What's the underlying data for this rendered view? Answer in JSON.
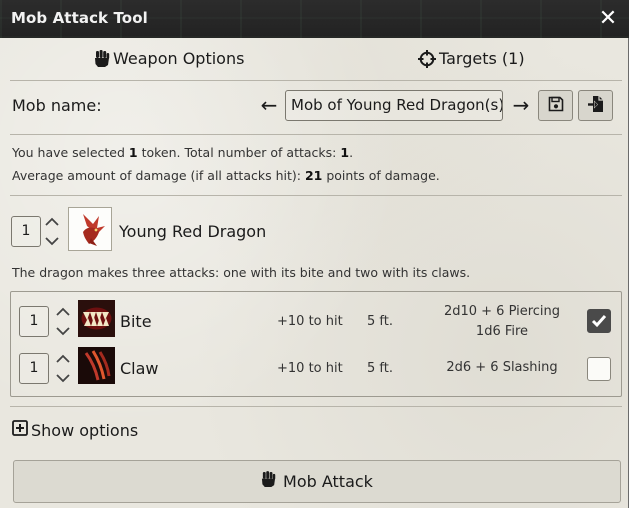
{
  "window": {
    "title": "Mob Attack Tool",
    "close_label": "✕"
  },
  "tabs": [
    {
      "label": "Weapon Options",
      "icon": "fist-icon"
    },
    {
      "label": "Targets (1)",
      "icon": "crosshair-icon"
    }
  ],
  "mob": {
    "name_label": "Mob name:",
    "name_value": "Mob of Young Red Dragon(s)",
    "prev_label": "←",
    "next_label": "→"
  },
  "summary": {
    "line1_a": "You have selected ",
    "selected_count": "1",
    "line1_b": " token. Total number of attacks: ",
    "total_attacks": "1",
    "line1_c": ".",
    "line2_a": "Average amount of damage (if all attacks hit): ",
    "avg_damage": "21",
    "line2_b": " points of damage."
  },
  "creature": {
    "count": "1",
    "name": "Young Red Dragon",
    "description": "The dragon makes three attacks: one with its bite and two with its claws."
  },
  "attacks": [
    {
      "count": "1",
      "name": "Bite",
      "to_hit": "+10 to hit",
      "range": "5 ft.",
      "damage_line1": "2d10  + 6 Piercing",
      "damage_line2": "1d6 Fire",
      "checked": true
    },
    {
      "count": "1",
      "name": "Claw",
      "to_hit": "+10 to hit",
      "range": "5 ft.",
      "damage_line1": "2d6  + 6 Slashing",
      "damage_line2": "",
      "checked": false
    }
  ],
  "options": {
    "show_options_label": "Show options"
  },
  "actions": {
    "mob_attack_label": "Mob Attack"
  },
  "colors": {
    "panel_bg": "#e9e7df",
    "titlebar_bg": "#222222",
    "checkbox_checked": "#4a4a4a"
  }
}
